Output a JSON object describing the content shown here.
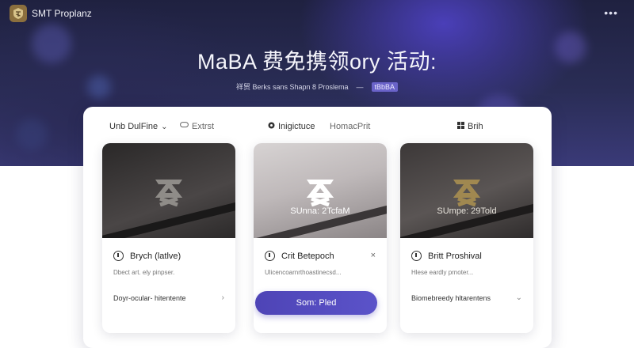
{
  "app": {
    "name": "SMT Proplanz"
  },
  "header": {
    "menu_icon": "more-dots-icon",
    "title": "MaBA 费免携领ory 活动:",
    "subtitle_left": "祥贸 Berks sans Shapn 8 Proslema",
    "subtitle_dash": "—",
    "subtitle_tag": "tBbBA"
  },
  "tabs": [
    {
      "label": "Unb DulFine",
      "icon": "chevron-down-icon"
    },
    {
      "label": "Extrst",
      "icon": "chat-bubble-icon"
    },
    {
      "label": "Inigictuce",
      "icon": "target-icon"
    },
    {
      "label": "HomacPrit",
      "icon": ""
    },
    {
      "label": "Brih",
      "icon": "grid-icon"
    }
  ],
  "cards": [
    {
      "thumb_label": "",
      "title": "Brych (latlve)",
      "description": "Dbect art. ely pinpser.",
      "footer": "Doyr-ocular- hitentente",
      "accent": "#3a3838"
    },
    {
      "thumb_label": "SUnna: 2TcfaM",
      "title": "Crit Betepoch",
      "description": "Ulicencoarnrthoastinecsd...",
      "cta": "Som: Pled",
      "accent": "#5a4fbf"
    },
    {
      "thumb_label": "SUmpe: 29Told",
      "title": "Britt Proshival",
      "description": "Hlese eardly prnoter...",
      "footer": "Biomebreedy  hltarentens",
      "accent": "#a08850"
    }
  ],
  "colors": {
    "primary": "#5048be",
    "hero_dark": "#1f2140",
    "hero_light": "#3a3a78"
  }
}
